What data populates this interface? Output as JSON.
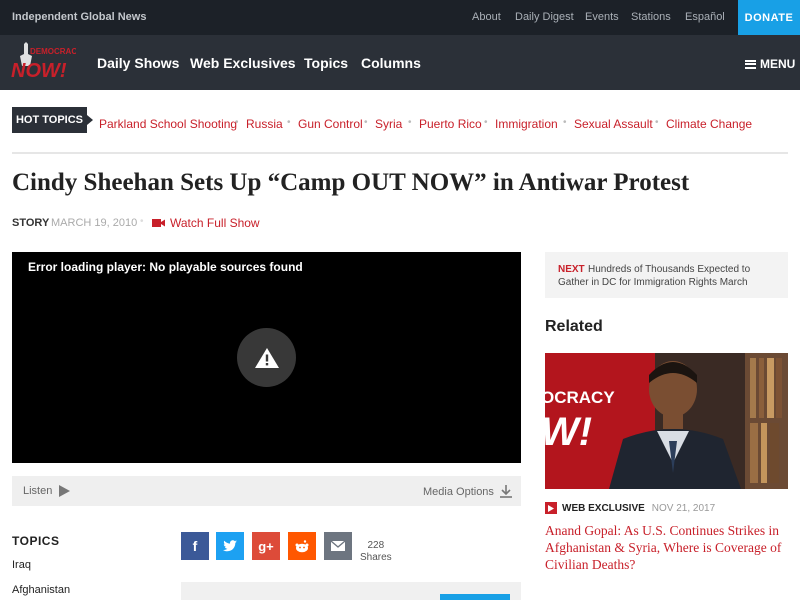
{
  "topbar": {
    "tagline": "Independent Global News",
    "links": [
      "About",
      "Daily Digest",
      "Events",
      "Stations",
      "Español"
    ],
    "donate": "DONATE"
  },
  "brand": {
    "logo_text_top": "DEMOCRACY",
    "logo_text_main": "NOW!"
  },
  "nav": {
    "items": [
      "Daily Shows",
      "Web Exclusives",
      "Topics",
      "Columns"
    ],
    "menu_label": "MENU"
  },
  "hot_topics": {
    "label": "HOT TOPICS",
    "items": [
      "Parkland School Shooting",
      "Russia",
      "Gun Control",
      "Syria",
      "Puerto Rico",
      "Immigration",
      "Sexual Assault",
      "Climate Change"
    ]
  },
  "article": {
    "title": "Cindy Sheehan Sets Up “Camp OUT NOW” in Antiwar Protest",
    "type": "STORY",
    "date": "MARCH 19, 2010",
    "watch_label": "Watch Full Show"
  },
  "player": {
    "error": "Error loading player: No playable sources found",
    "listen_label": "Listen",
    "media_options_label": "Media Options"
  },
  "topics": {
    "heading": "TOPICS",
    "items": [
      "Iraq",
      "Afghanistan"
    ]
  },
  "share": {
    "count": "228",
    "label": "Shares",
    "icons": [
      "facebook-icon",
      "twitter-icon",
      "google-plus-icon",
      "reddit-icon",
      "email-icon"
    ]
  },
  "next": {
    "label": "NEXT",
    "text": "Hundreds of Thousands Expected to Gather in DC for Immigration Rights March"
  },
  "related": {
    "heading": "Related",
    "image_overlay_top": "OCRACY",
    "image_overlay_bottom": "W!",
    "tag": "WEB EXCLUSIVE",
    "date": "NOV 21, 2017",
    "title": "Anand Gopal: As U.S. Continues Strikes in Afghanistan & Syria, Where is Coverage of Civilian Deaths?"
  },
  "colors": {
    "brand_red": "#c8202a",
    "accent_blue": "#18a0e6",
    "topbar_bg": "#1c2128",
    "navbar_bg": "#2b3038"
  }
}
